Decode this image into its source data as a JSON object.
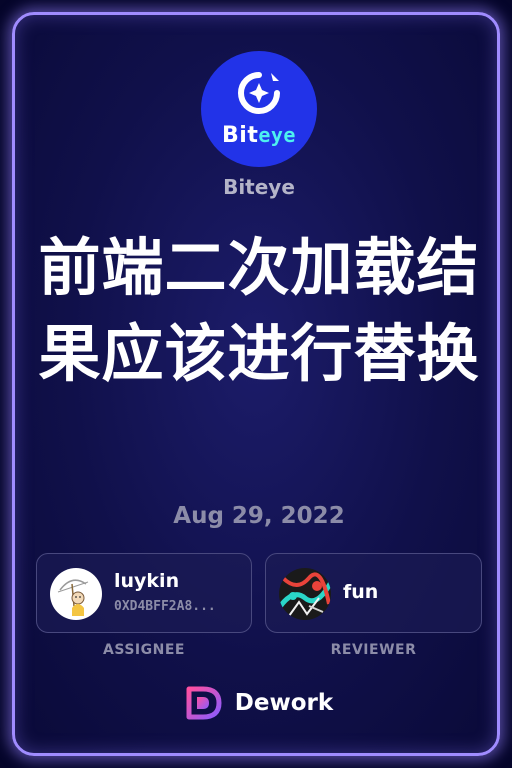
{
  "brand": {
    "logo_text_main": "Bit",
    "logo_text_accent": "eye",
    "name": "Biteye",
    "logo_color": "#2233e8"
  },
  "task": {
    "title": "前端二次加载结果应该进行替换",
    "date": "Aug 29, 2022"
  },
  "assignee": {
    "name": "luykin",
    "address": "0XD4BFF2A8...",
    "role": "ASSIGNEE",
    "avatar_icon": "girl-with-umbrella-avatar"
  },
  "reviewer": {
    "name": "fun",
    "role": "REVIEWER",
    "avatar_icon": "abstract-art-avatar"
  },
  "footer": {
    "platform": "Dework",
    "icon": "dework-logo-icon"
  },
  "colors": {
    "border_glow": "#a08cff",
    "card_bg": "#10104a",
    "muted_text": "#8c8ca8"
  }
}
